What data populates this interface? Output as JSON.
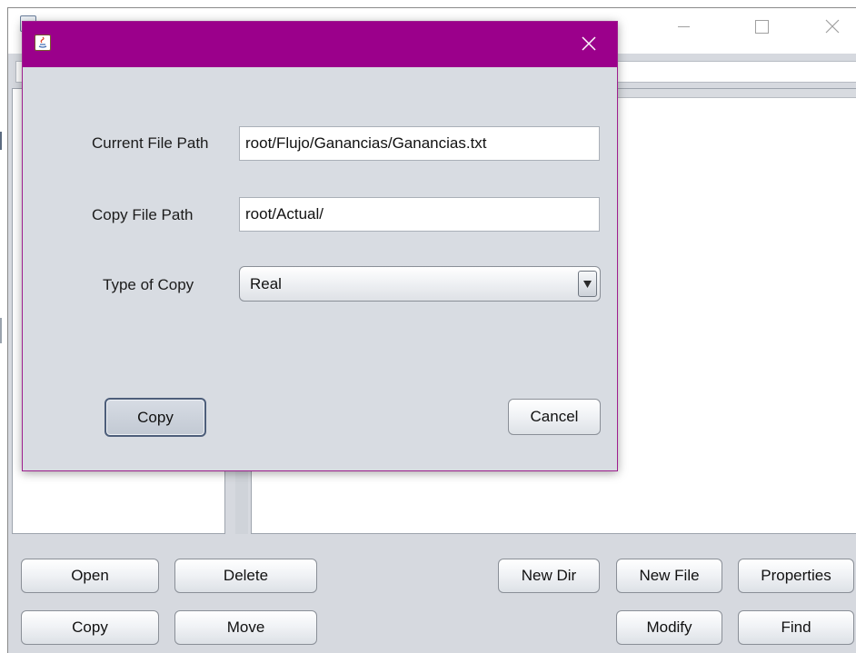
{
  "main_window": {
    "buttons": {
      "open": "Open",
      "delete": "Delete",
      "new_dir": "New Dir",
      "new_file": "New File",
      "properties": "Properties",
      "copy": "Copy",
      "move": "Move",
      "modify": "Modify",
      "find": "Find"
    }
  },
  "dialog": {
    "titlebar_color": "#9b008b",
    "icon": "java-icon",
    "fields": {
      "current_file_path": {
        "label": "Current File Path",
        "value": "root/Flujo/Ganancias/Ganancias.txt"
      },
      "copy_file_path": {
        "label": "Copy File Path",
        "value": "root/Actual/"
      },
      "type_of_copy": {
        "label": "Type of Copy",
        "selected": "Real"
      }
    },
    "buttons": {
      "copy": "Copy",
      "cancel": "Cancel"
    }
  }
}
